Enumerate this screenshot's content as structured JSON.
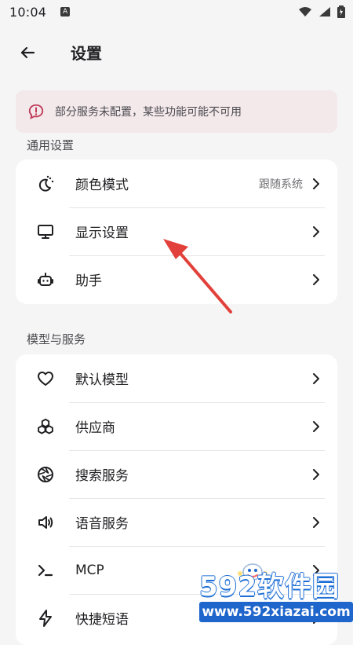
{
  "status_bar": {
    "time": "10:04",
    "left_icon_letter": "A",
    "icons": [
      "notification-a-icon",
      "wifi-icon",
      "signal-icon",
      "battery-icon"
    ]
  },
  "app_bar": {
    "title": "设置",
    "back_icon": "arrow-left-icon"
  },
  "alert": {
    "icon": "message-alert-icon",
    "text": "部分服务未配置，某些功能可能不可用",
    "accent_color": "#c13a57",
    "bg_color": "#f3e8ea"
  },
  "sections": [
    {
      "title": "通用设置",
      "items": [
        {
          "label": "颜色模式",
          "value": "跟随系统",
          "icon": "theme-mode-icon"
        },
        {
          "label": "显示设置",
          "value": "",
          "icon": "monitor-icon"
        },
        {
          "label": "助手",
          "value": "",
          "icon": "robot-icon"
        }
      ]
    },
    {
      "title": "模型与服务",
      "items": [
        {
          "label": "默认模型",
          "value": "",
          "icon": "heart-icon"
        },
        {
          "label": "供应商",
          "value": "",
          "icon": "boxes-icon"
        },
        {
          "label": "搜索服务",
          "value": "",
          "icon": "aperture-icon"
        },
        {
          "label": "语音服务",
          "value": "",
          "icon": "speaker-icon"
        },
        {
          "label": "MCP",
          "value": "",
          "icon": "terminal-icon"
        },
        {
          "label": "快捷短语",
          "value": "",
          "icon": "lightning-icon"
        }
      ]
    }
  ],
  "watermark": {
    "brand": "592软件园",
    "url": "www.592xiazai.com",
    "color": "#1f66cc"
  },
  "colors": {
    "background": "#f5f5f6",
    "card": "#ffffff",
    "arrow": "#e2403a"
  }
}
